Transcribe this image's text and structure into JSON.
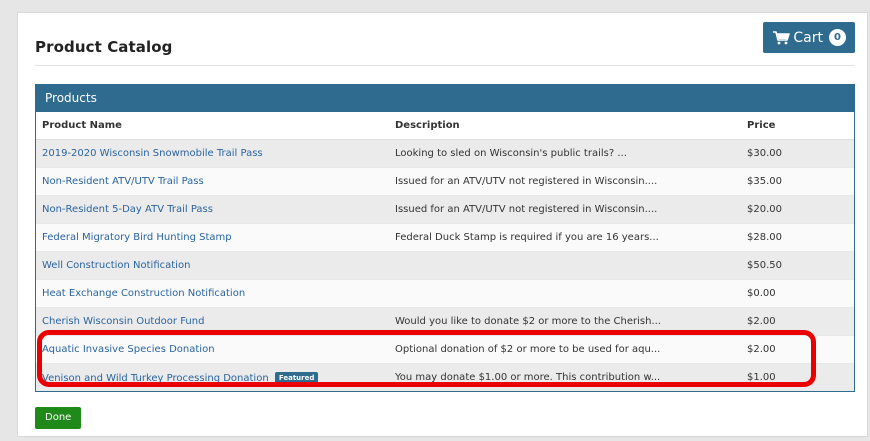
{
  "header": {
    "title": "Product Catalog",
    "cart_label": "Cart",
    "cart_count": "0",
    "cart_icon": "shopping-cart-icon"
  },
  "panel": {
    "heading": "Products",
    "columns": {
      "name": "Product Name",
      "description": "Description",
      "price": "Price"
    },
    "rows": [
      {
        "name": "2019-2020 Wisconsin Snowmobile Trail Pass",
        "description": "Looking to sled on Wisconsin's public trails? ...",
        "price": "$30.00"
      },
      {
        "name": "Non-Resident ATV/UTV Trail Pass",
        "description": "Issued for an ATV/UTV not registered in Wisconsin....",
        "price": "$35.00"
      },
      {
        "name": "Non-Resident 5-Day ATV Trail Pass",
        "description": "Issued for an ATV/UTV not registered in Wisconsin....",
        "price": "$20.00"
      },
      {
        "name": "Federal Migratory Bird Hunting Stamp",
        "description": "Federal Duck Stamp is required if you are 16 years...",
        "price": "$28.00"
      },
      {
        "name": "Well Construction Notification",
        "description": "",
        "price": "$50.50"
      },
      {
        "name": "Heat Exchange Construction Notification",
        "description": "",
        "price": "$0.00"
      },
      {
        "name": "Cherish Wisconsin Outdoor Fund",
        "description": "Would you like to donate $2 or more to the Cherish...",
        "price": "$2.00"
      },
      {
        "name": "Aquatic Invasive Species Donation",
        "description": "Optional donation of $2 or more to be used for aqu...",
        "price": "$2.00"
      },
      {
        "name": "Venison and Wild Turkey Processing Donation",
        "badge": "Featured",
        "description": "You may donate $1.00 or more. This contribution w...",
        "price": "$1.00"
      }
    ]
  },
  "footer": {
    "done_label": "Done"
  },
  "colors": {
    "primary": "#2f6a8f",
    "link": "#2a64a0",
    "done": "#1f8a1a",
    "highlight": "#ea0000"
  }
}
